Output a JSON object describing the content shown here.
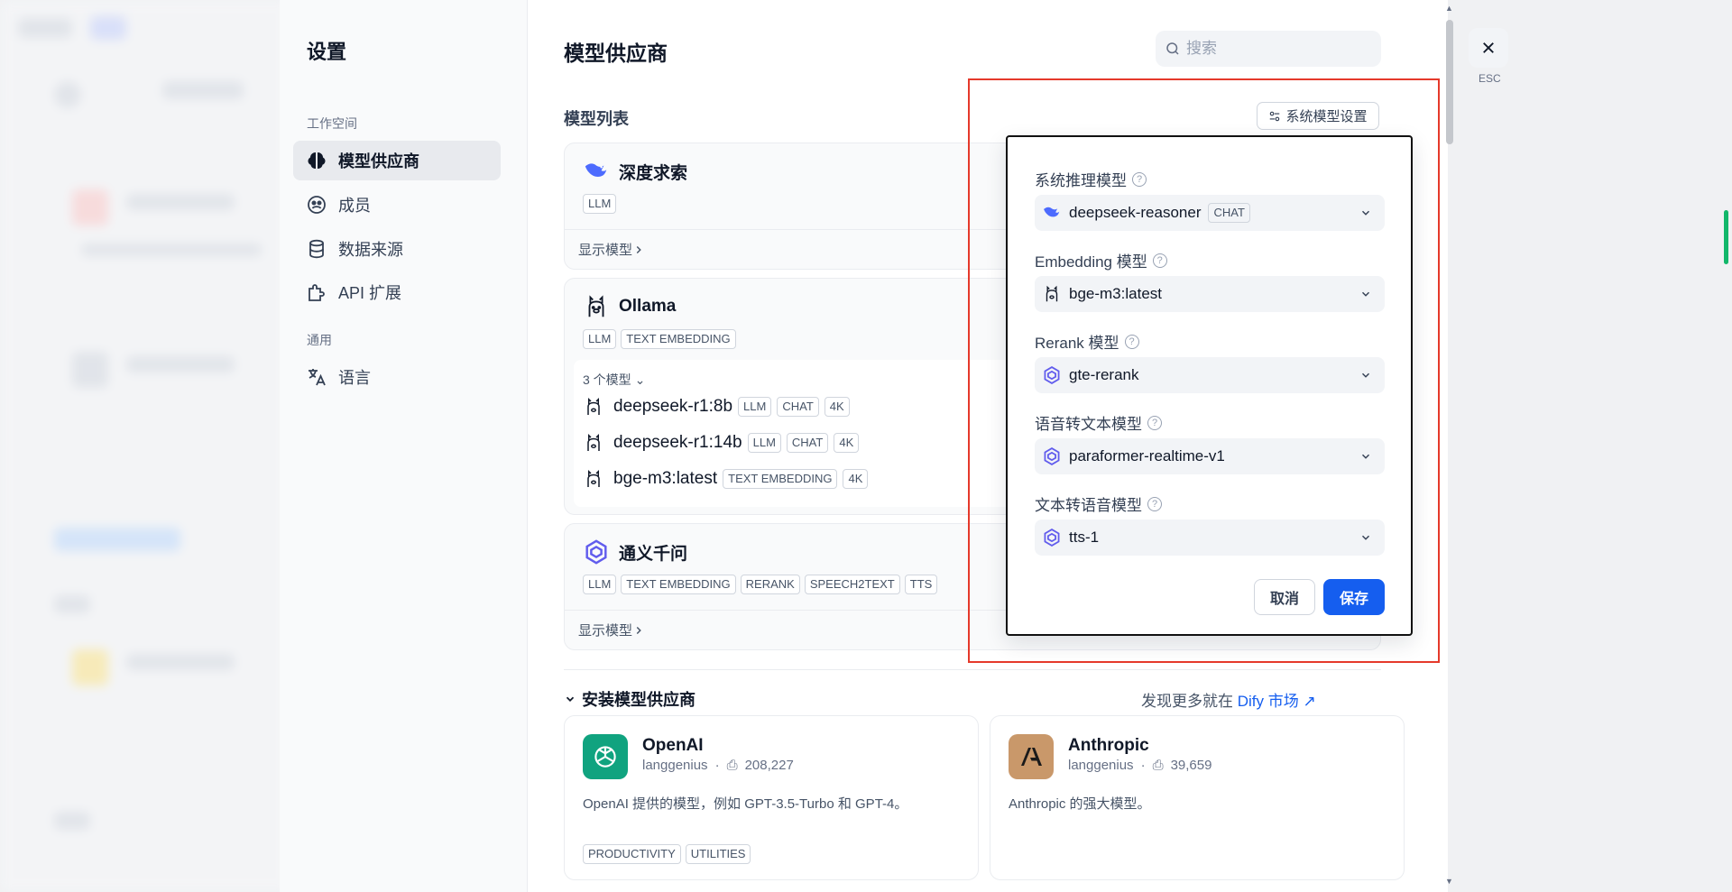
{
  "settings": {
    "title": "设置",
    "group_workspace": "工作空间",
    "group_general": "通用",
    "nav": [
      {
        "label": "模型供应商",
        "icon": "brain-icon"
      },
      {
        "label": "成员",
        "icon": "members-icon"
      },
      {
        "label": "数据来源",
        "icon": "database-icon"
      },
      {
        "label": "API 扩展",
        "icon": "puzzle-icon"
      },
      {
        "label": "语言",
        "icon": "translate-icon"
      }
    ]
  },
  "content": {
    "title": "模型供应商",
    "search_placeholder": "搜索",
    "model_list_title": "模型列表",
    "system_model_button": "系统模型设置",
    "providers": [
      {
        "name": "深度求索",
        "tags": [
          "LLM"
        ],
        "footer": "显示模型"
      },
      {
        "name": "Ollama",
        "tags": [
          "LLM",
          "TEXT EMBEDDING"
        ],
        "model_count": "3 个模型",
        "models": [
          {
            "name": "deepseek-r1:8b",
            "tags": [
              "LLM",
              "CHAT",
              "4K"
            ]
          },
          {
            "name": "deepseek-r1:14b",
            "tags": [
              "LLM",
              "CHAT",
              "4K"
            ]
          },
          {
            "name": "bge-m3:latest",
            "tags": [
              "TEXT EMBEDDING",
              "4K"
            ]
          }
        ]
      },
      {
        "name": "通义千问",
        "tags": [
          "LLM",
          "TEXT EMBEDDING",
          "RERANK",
          "SPEECH2TEXT",
          "TTS"
        ],
        "footer": "显示模型"
      }
    ],
    "install_title": "安装模型供应商",
    "market_prefix": "发现更多就在",
    "market_link": "Dify 市场",
    "install_cards": [
      {
        "name": "OpenAI",
        "author": "langgenius",
        "downloads": "208,227",
        "desc": "OpenAI 提供的模型，例如 GPT-3.5-Turbo 和 GPT-4。",
        "tags": [
          "PRODUCTIVITY",
          "UTILITIES"
        ],
        "logo_color": "#10a37f"
      },
      {
        "name": "Anthropic",
        "author": "langgenius",
        "downloads": "39,659",
        "desc": "Anthropic 的强大模型。",
        "tags": [],
        "logo_color": "#c9986a"
      }
    ]
  },
  "popup": {
    "fields": [
      {
        "label": "系统推理模型",
        "value": "deepseek-reasoner",
        "badge": "CHAT",
        "icon": "deepseek-icon"
      },
      {
        "label": "Embedding 模型",
        "value": "bge-m3:latest",
        "badge": "",
        "icon": "ollama-icon"
      },
      {
        "label": "Rerank 模型",
        "value": "gte-rerank",
        "badge": "",
        "icon": "tongyi-icon"
      },
      {
        "label": "语音转文本模型",
        "value": "paraformer-realtime-v1",
        "badge": "",
        "icon": "tongyi-icon"
      },
      {
        "label": "文本转语音模型",
        "value": "tts-1",
        "badge": "",
        "icon": "tongyi-icon"
      }
    ],
    "cancel": "取消",
    "save": "保存"
  },
  "close_label": "ESC",
  "colors": {
    "accent": "#155eef",
    "highlight": "#e5392b",
    "deepseek": "#4d6bfe",
    "tongyi": "#615ced"
  }
}
